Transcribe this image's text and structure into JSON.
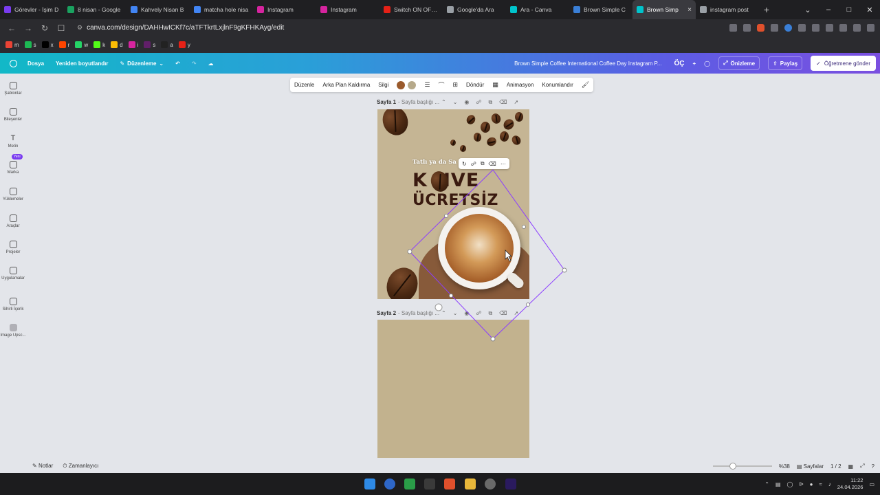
{
  "browser": {
    "tabs": [
      {
        "label": "Görevler - İşim D",
        "icon_color": "#7a3cf0"
      },
      {
        "label": "8 nisan - Google",
        "icon_color": "#1aa260"
      },
      {
        "label": "Kahvely Nisan B",
        "icon_color": "#4285f4"
      },
      {
        "label": "matcha hole nisa",
        "icon_color": "#4285f4"
      },
      {
        "label": "Instagram",
        "icon_color": "#d6249f"
      },
      {
        "label": "Instagram",
        "icon_color": "#d6249f"
      },
      {
        "label": "Switch ON OFF G",
        "icon_color": "#e62117"
      },
      {
        "label": "Google'da Ara",
        "icon_color": "#9aa0a6"
      },
      {
        "label": "Ara - Canva",
        "icon_color": "#00c4cc"
      },
      {
        "label": "Brown Simple C",
        "icon_color": "#3a7fd7"
      },
      {
        "label": "Brown Simp",
        "icon_color": "#00c4cc",
        "active": true
      },
      {
        "label": "instagram post",
        "icon_color": "#9aa0a6"
      }
    ],
    "new_tab": "+",
    "url": "canva.com/design/DAHHwICKf7c/aTFTkrtLxjlnF9gKFHKAyg/edit",
    "bookmarks": [
      {
        "label": "m",
        "color": "#ea4335"
      },
      {
        "label": "s",
        "color": "#1db954"
      },
      {
        "label": "x",
        "color": "#000000"
      },
      {
        "label": "r",
        "color": "#ff4500"
      },
      {
        "label": "w",
        "color": "#25d366"
      },
      {
        "label": "k",
        "color": "#53fc18"
      },
      {
        "label": "d",
        "color": "#fbbc04"
      },
      {
        "label": "i",
        "color": "#d6249f"
      },
      {
        "label": "s",
        "color": "#611f69"
      },
      {
        "label": "a",
        "color": "#222222"
      },
      {
        "label": "y",
        "color": "#e62117"
      }
    ]
  },
  "canva": {
    "menu": {
      "file": "Dosya",
      "resize": "Yeniden boyutlandır",
      "edit": "Düzenleme"
    },
    "doc_title": "Brown Simple Coffee International Coffee Day Instagram P...",
    "avatar": "ÖÇ",
    "preview": "Önizleme",
    "share": "Paylaş",
    "send_teacher": "Öğretmene gönder",
    "sidebar": [
      {
        "label": "Şablonlar"
      },
      {
        "label": "Bileşenler"
      },
      {
        "label": "Metin"
      },
      {
        "label": "Marka",
        "badge": "Yeni"
      },
      {
        "label": "Yüklemeler"
      },
      {
        "label": "Araçlar"
      },
      {
        "label": "Projeler"
      },
      {
        "label": "Uygulamalar"
      },
      {
        "label": "Sihirli İçerik"
      },
      {
        "label": "Image Upsc..."
      }
    ],
    "context_toolbar": {
      "edit": "Düzenle",
      "bg_remove": "Arka Plan Kaldırma",
      "erase": "Silgi",
      "color1": "#9a5a2c",
      "color2": "#b6a98a",
      "rotate": "Döndür",
      "animation": "Animasyon",
      "position": "Konumlandır"
    },
    "page1": {
      "label": "Sayfa 1",
      "subtitle": "- Sayfa başlığı ...",
      "small_text": "Tatlı ya da Sa",
      "headline1": "K  HVE",
      "headline2": "ÜCRETSİZ"
    },
    "page2": {
      "label": "Sayfa 2",
      "subtitle": "- Sayfa başlığı ..."
    },
    "status": {
      "notes": "Notlar",
      "timer": "Zamanlayıcı",
      "zoom": "%38",
      "pages": "Sayfalar",
      "page_count": "1 / 2"
    }
  },
  "taskbar": {
    "time": "11:22",
    "date": "24.04.2026"
  }
}
